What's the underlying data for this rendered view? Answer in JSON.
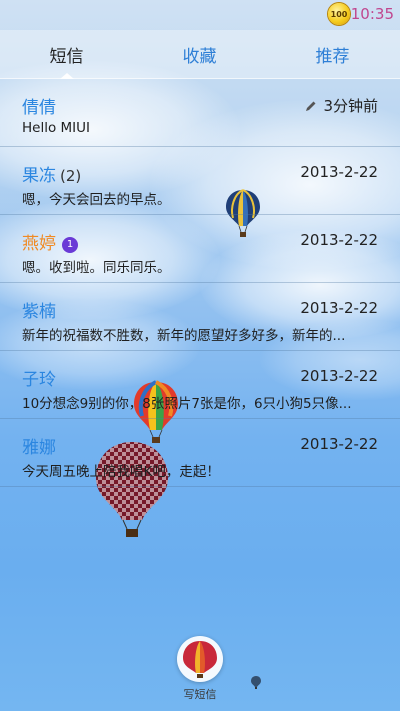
{
  "status_bar": {
    "battery_level": "100",
    "time": "10:35",
    "time_color": "#c0468e"
  },
  "tabs": [
    {
      "label": "短信",
      "active": true
    },
    {
      "label": "收藏",
      "active": false
    },
    {
      "label": "推荐",
      "active": false
    }
  ],
  "threads": [
    {
      "name": "倩倩",
      "count": "",
      "date": "3分钟前",
      "snippet": "Hello MIUI",
      "draft": true,
      "unread": ""
    },
    {
      "name": "果冻",
      "count": "(2)",
      "date": "2013-2-22",
      "snippet": "嗯，今天会回去的早点。",
      "draft": false,
      "unread": ""
    },
    {
      "name": "燕婷",
      "count": "",
      "date": "2013-2-22",
      "snippet": "嗯。收到啦。同乐同乐。",
      "draft": false,
      "unread": "1"
    },
    {
      "name": "紫楠",
      "count": "",
      "date": "2013-2-22",
      "snippet": "新年的祝福数不胜数，新年的愿望好多好多，新年的...",
      "draft": false,
      "unread": ""
    },
    {
      "name": "子玲",
      "count": "",
      "date": "2013-2-22",
      "snippet": "10分想念9别的你，8张照片7张是你，6只小狗5只像...",
      "draft": false,
      "unread": ""
    },
    {
      "name": "雅娜",
      "count": "",
      "date": "2013-2-22",
      "snippet": "今天周五晚上陪我唱K吧，走起！",
      "draft": false,
      "unread": ""
    }
  ],
  "compose": {
    "label": "写短信"
  },
  "colors": {
    "accent": "#2b86e0",
    "unread_name": "#f08a24",
    "unread_badge": "#6a3ad6"
  },
  "icons": {
    "draft": "pencil-icon",
    "battery": "battery-icon",
    "compose": "balloon-compose-icon"
  }
}
